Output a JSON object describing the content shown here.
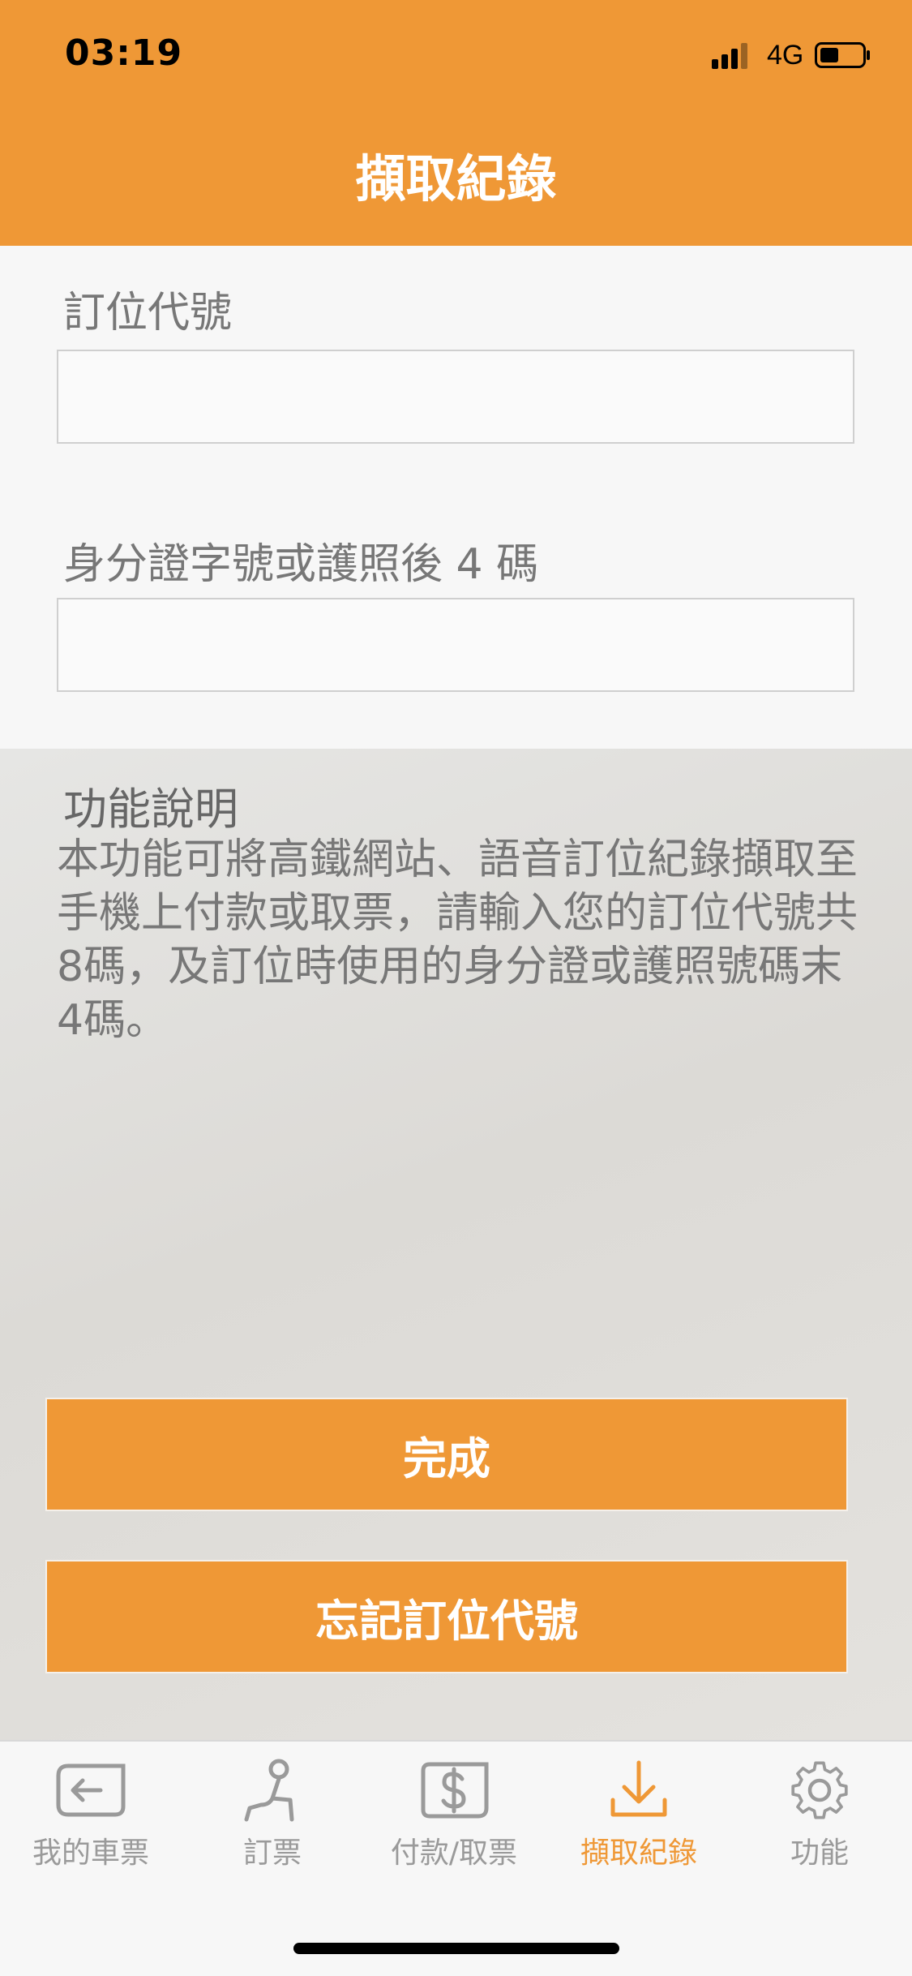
{
  "status_bar": {
    "time": "03:19",
    "network": "4G"
  },
  "header": {
    "title": "擷取紀錄"
  },
  "form": {
    "booking_code_label": "訂位代號",
    "booking_code_value": "",
    "id_label": "身分證字號或護照後 4 碼",
    "id_value": ""
  },
  "description": {
    "title": "功能說明",
    "text": "本功能可將高鐵網站、語音訂位紀錄擷取至手機上付款或取票，請輸入您的訂位代號共8碼，及訂位時使用的身分證或護照號碼末4碼。"
  },
  "buttons": {
    "done_label": "完成",
    "forgot_label": "忘記訂位代號"
  },
  "tabbar": {
    "items": [
      {
        "label": "我的車票",
        "icon": "back-ticket-icon"
      },
      {
        "label": "訂票",
        "icon": "seat-icon"
      },
      {
        "label": "付款/取票",
        "icon": "dollar-icon"
      },
      {
        "label": "擷取紀錄",
        "icon": "download-icon",
        "active": true
      },
      {
        "label": "功能",
        "icon": "gear-icon"
      }
    ]
  },
  "colors": {
    "accent": "#ef9836",
    "inactive": "#9a9a9a",
    "text_gray": "#777777"
  }
}
